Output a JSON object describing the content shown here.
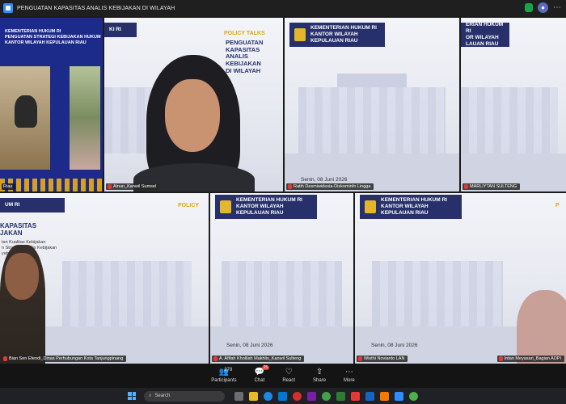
{
  "window": {
    "title": "PENGUATAN KAPASITAS ANALIS KEBIJAKAN DI WILAYAH"
  },
  "slide": {
    "policy_talks": "POLICY TALKS",
    "title_line1": "PENGUATAN KAPASITAS",
    "title_line2": "ANALIS KEBIJAKAN",
    "title_line3": "DI WILAYAH",
    "subtitle_line1": "Mendorong Peningkatan Kualitas Kebijakan",
    "subtitle_line2": "Publik melalui Peran Strategis Analis Kebijakan",
    "subtitle_line3": "di Wilayah",
    "logo_line1": "KEMENTERIAN HUKUM RI",
    "logo_line2": "KANTOR WILAYAH",
    "logo_line3": "KEPULAUAN RIAU",
    "date": "Senin, 08 Juni 2026"
  },
  "presentation": {
    "head_line1": "KEMENTERIAN HUKUM RI",
    "head_line2": "PENGUATAN STRATEGI KEBIJAKAN HUKUM",
    "head_line3": "KANTOR WILAYAH KEPULAUAN RIAU",
    "tag": "Riau"
  },
  "participants": [
    {
      "name": "Ainun_Kanwil Sumsel"
    },
    {
      "name": "Ratih Desmiwidesia-Diskominfo Lingga"
    },
    {
      "name": "MARLIYTAN SULTENG"
    },
    {
      "name": "Bian Sen Efendi_Dinas Perhubungan Kota Tanjungpinang"
    },
    {
      "name": "A. Afifah Kholilah Makhlis_Kanwil Sulteng"
    },
    {
      "name": "Wisthi Novianto LAN"
    },
    {
      "name": "Intan Meyasari_Bagian ADPI"
    }
  ],
  "toolbar": {
    "participants_label": "Participants",
    "participants_count": "278",
    "chat_label": "Chat",
    "chat_badge": "25",
    "react_label": "React",
    "share_label": "Share",
    "more_label": "More"
  },
  "taskbar": {
    "search_placeholder": "Search"
  }
}
